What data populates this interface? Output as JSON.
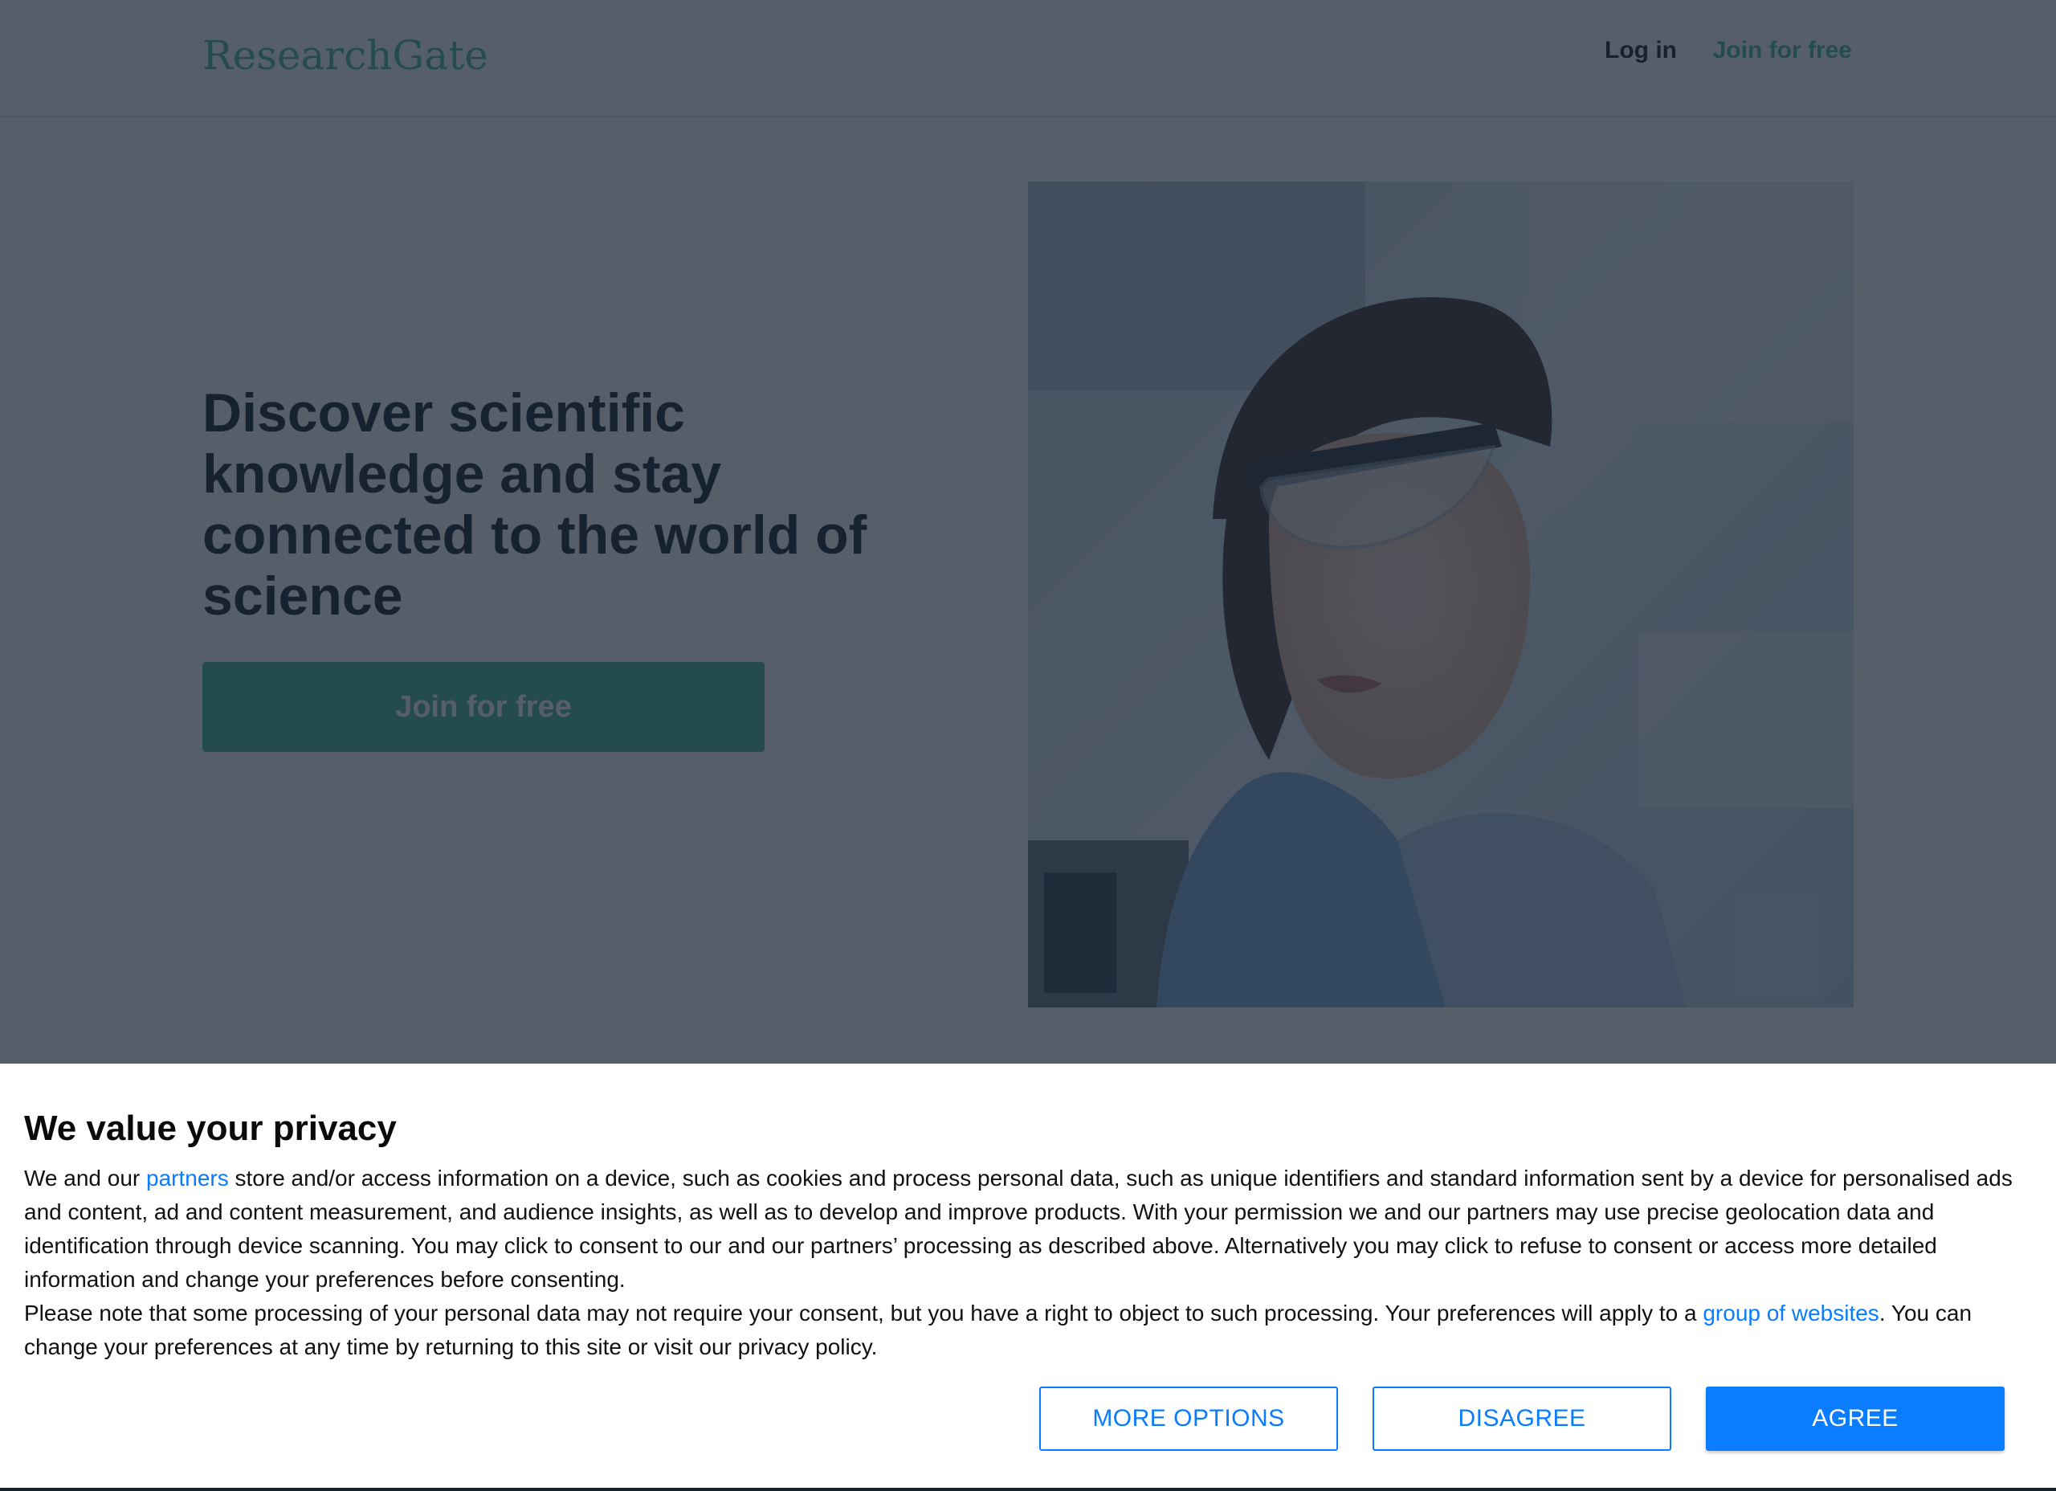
{
  "header": {
    "logo": "ResearchGate",
    "login_label": "Log in",
    "join_label": "Join for free"
  },
  "hero": {
    "heading": "Discover scientific knowledge and stay connected to the world of science",
    "cta_label": "Join for free",
    "image_icon": "scientist-photo"
  },
  "consent": {
    "title": "We value your privacy",
    "p1_before": "We and our ",
    "p1_link": "partners",
    "p1_after": " store and/or access information on a device, such as cookies and process personal data, such as unique identifiers and standard information sent by a device for personalised ads and content, ad and content measurement, and audience insights, as well as to develop and improve products. With your permission we and our partners may use precise geolocation data and identification through device scanning. You may click to consent to our and our partners’ processing as described above. Alternatively you may click to refuse to consent or access more detailed information and change your preferences before consenting.",
    "p2_before": "Please note that some processing of your personal data may not require your consent, but you have a right to object to such processing. Your preferences will apply to a ",
    "p2_link": "group of websites",
    "p2_after": ". You can change your preferences at any time by returning to this site or visit our privacy policy.",
    "buttons": {
      "more_options": "MORE OPTIONS",
      "disagree": "DISAGREE",
      "agree": "AGREE"
    }
  },
  "colors": {
    "brand": "#40ba9b",
    "consent_accent": "#0a7cff",
    "overlay": "#1b2634"
  }
}
